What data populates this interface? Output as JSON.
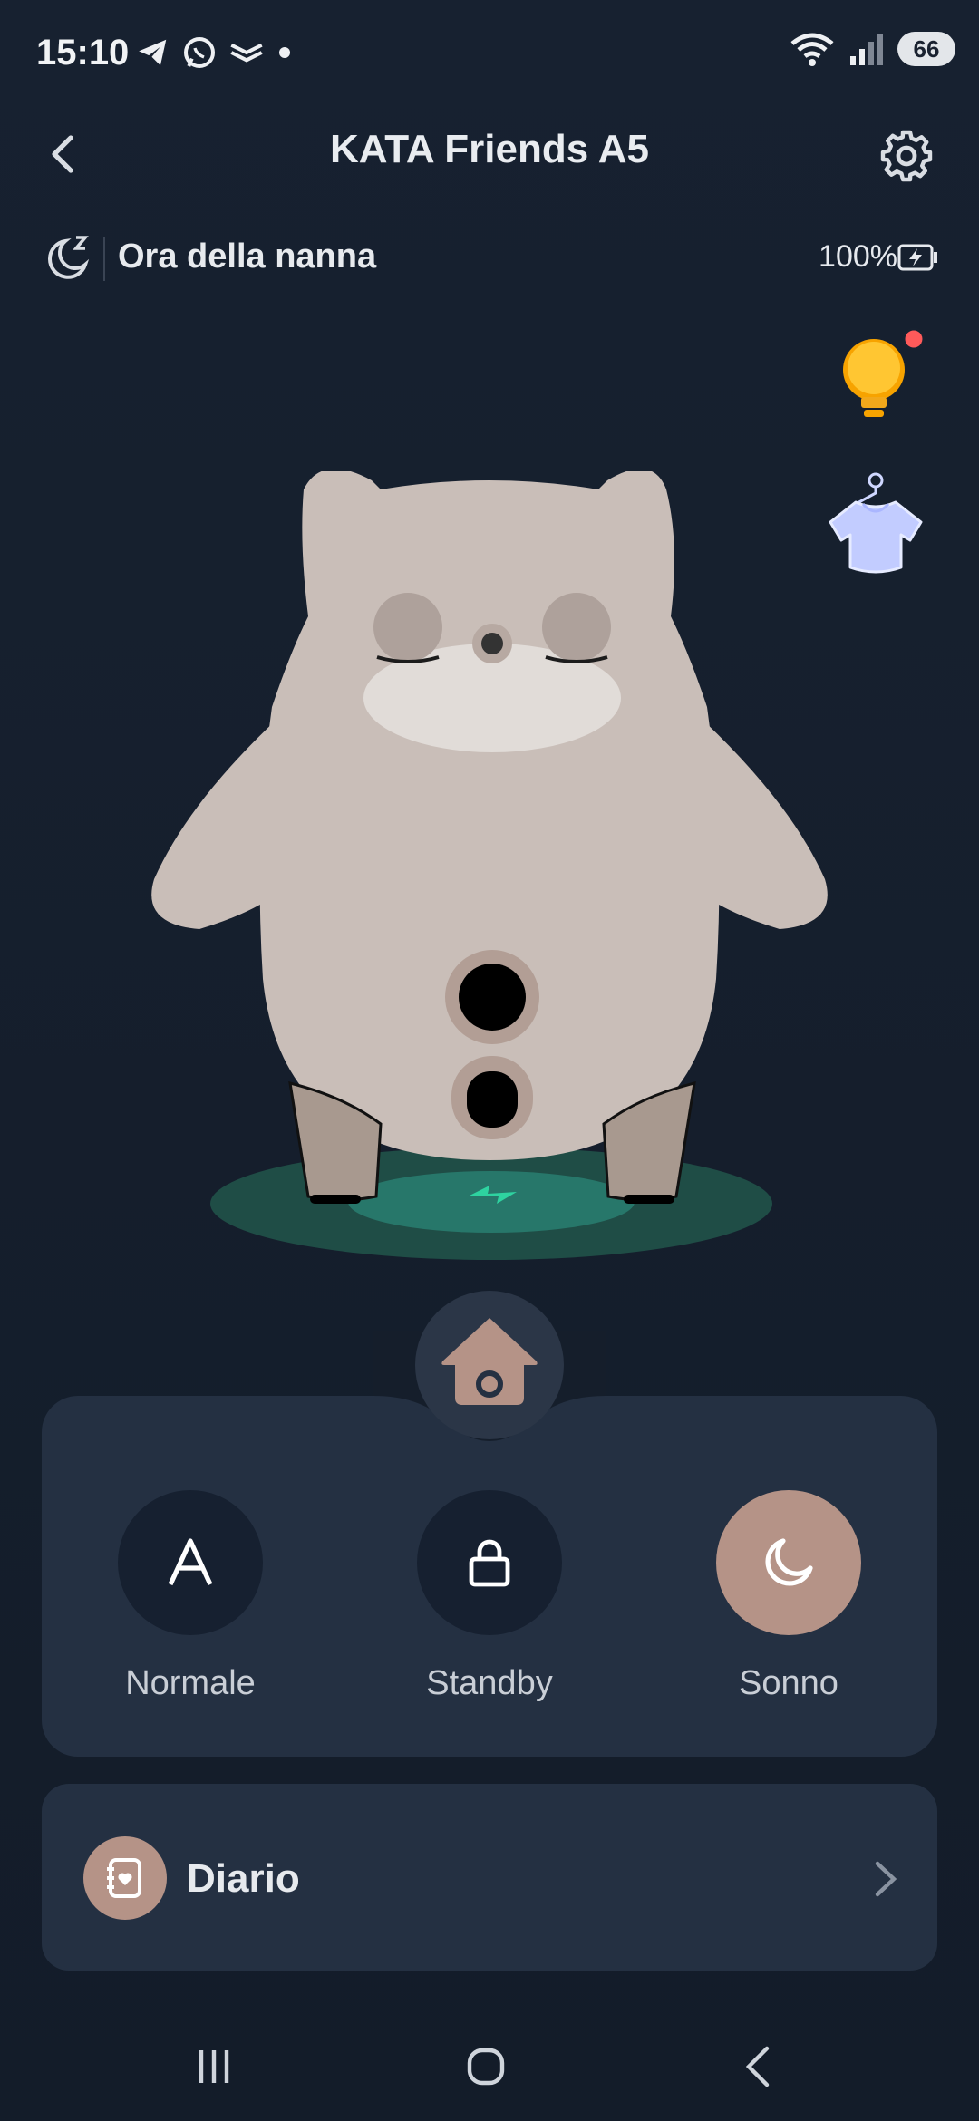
{
  "status_bar": {
    "time": "15:10",
    "battery": "66",
    "icons": [
      "telegram-icon",
      "whatsapp-icon",
      "mail-icon",
      "dot-icon",
      "wifi-icon",
      "signal-icon"
    ]
  },
  "header": {
    "title": "KATA Friends A5",
    "back_icon": "chevron-left-icon",
    "settings_icon": "gear-icon"
  },
  "device_status": {
    "mode_label": "Ora della nanna",
    "battery_percent": "100%",
    "mode_icon": "moon-z-icon",
    "battery_icon": "battery-charging-icon"
  },
  "side_actions": [
    {
      "name": "light-bulb-icon",
      "has_badge": true,
      "badge_color": "#ff5a5a"
    },
    {
      "name": "shirt-hanger-icon"
    }
  ],
  "robot": {
    "state": "sleeping",
    "charging": true,
    "charge_color": "#2ed3a0"
  },
  "controls": {
    "home_icon": "home-icon",
    "modes": [
      {
        "label": "Normale",
        "icon": "letter-a-icon",
        "active": false
      },
      {
        "label": "Standby",
        "icon": "lock-icon",
        "active": false
      },
      {
        "label": "Sonno",
        "icon": "moon-icon",
        "active": true
      }
    ]
  },
  "diario": {
    "label": "Diario",
    "icon": "journal-heart-icon",
    "chevron": "chevron-right-icon"
  },
  "colors": {
    "background": "#151e2b",
    "card": "#243042",
    "accent": "#b59387",
    "robot_body": "#c9beb8"
  }
}
